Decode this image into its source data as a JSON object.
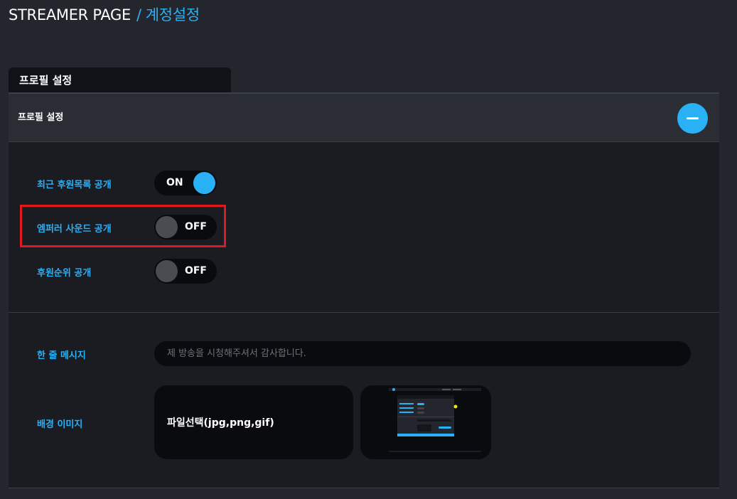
{
  "breadcrumb": {
    "root": "STREAMER PAGE",
    "separator": "/",
    "current": "계정설정"
  },
  "tab": {
    "label": "프로필 설정"
  },
  "panel": {
    "title": "프로필 설정",
    "collapse_icon": "minus-icon"
  },
  "settings": [
    {
      "label": "최근 후원목록 공개",
      "state": "ON"
    },
    {
      "label": "엠퍼러 사운드 공개",
      "state": "OFF"
    },
    {
      "label": "후원순위 공개",
      "state": "OFF"
    }
  ],
  "message": {
    "label": "한 줄 메시지",
    "placeholder": "제 방송을 시청해주셔서 감사합니다."
  },
  "background_image": {
    "label": "배경 이미지",
    "file_button": "파일선택(jpg,png,gif)"
  },
  "colors": {
    "accent": "#2ab0f5",
    "highlight": "#e0191e",
    "background": "#24262d"
  }
}
